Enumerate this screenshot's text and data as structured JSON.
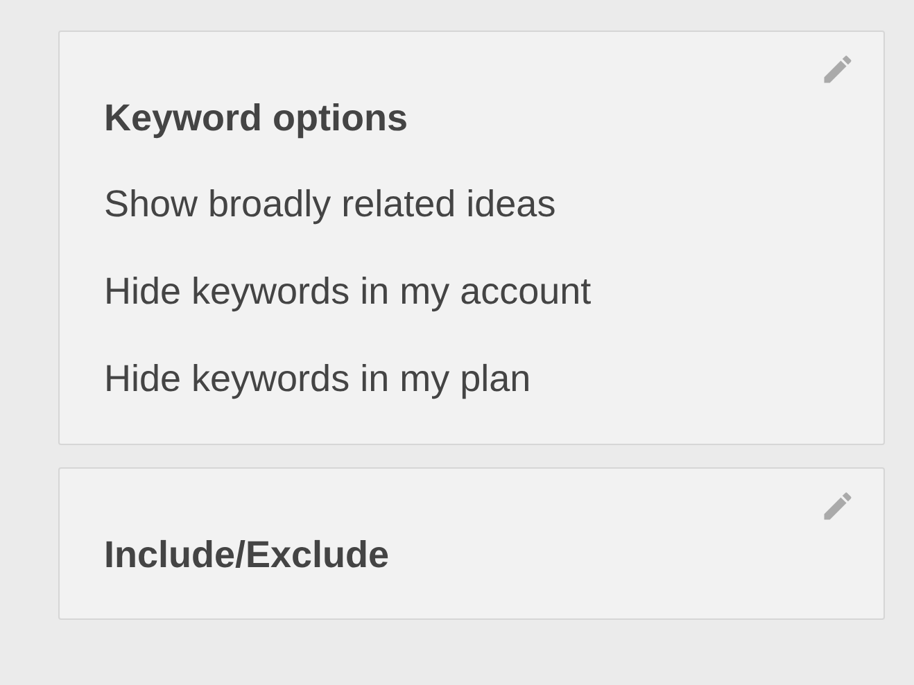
{
  "sections": [
    {
      "title": "Keyword options",
      "items": [
        "Show broadly related ideas",
        "Hide keywords in my account",
        "Hide keywords in my plan"
      ]
    },
    {
      "title": "Include/Exclude"
    }
  ]
}
